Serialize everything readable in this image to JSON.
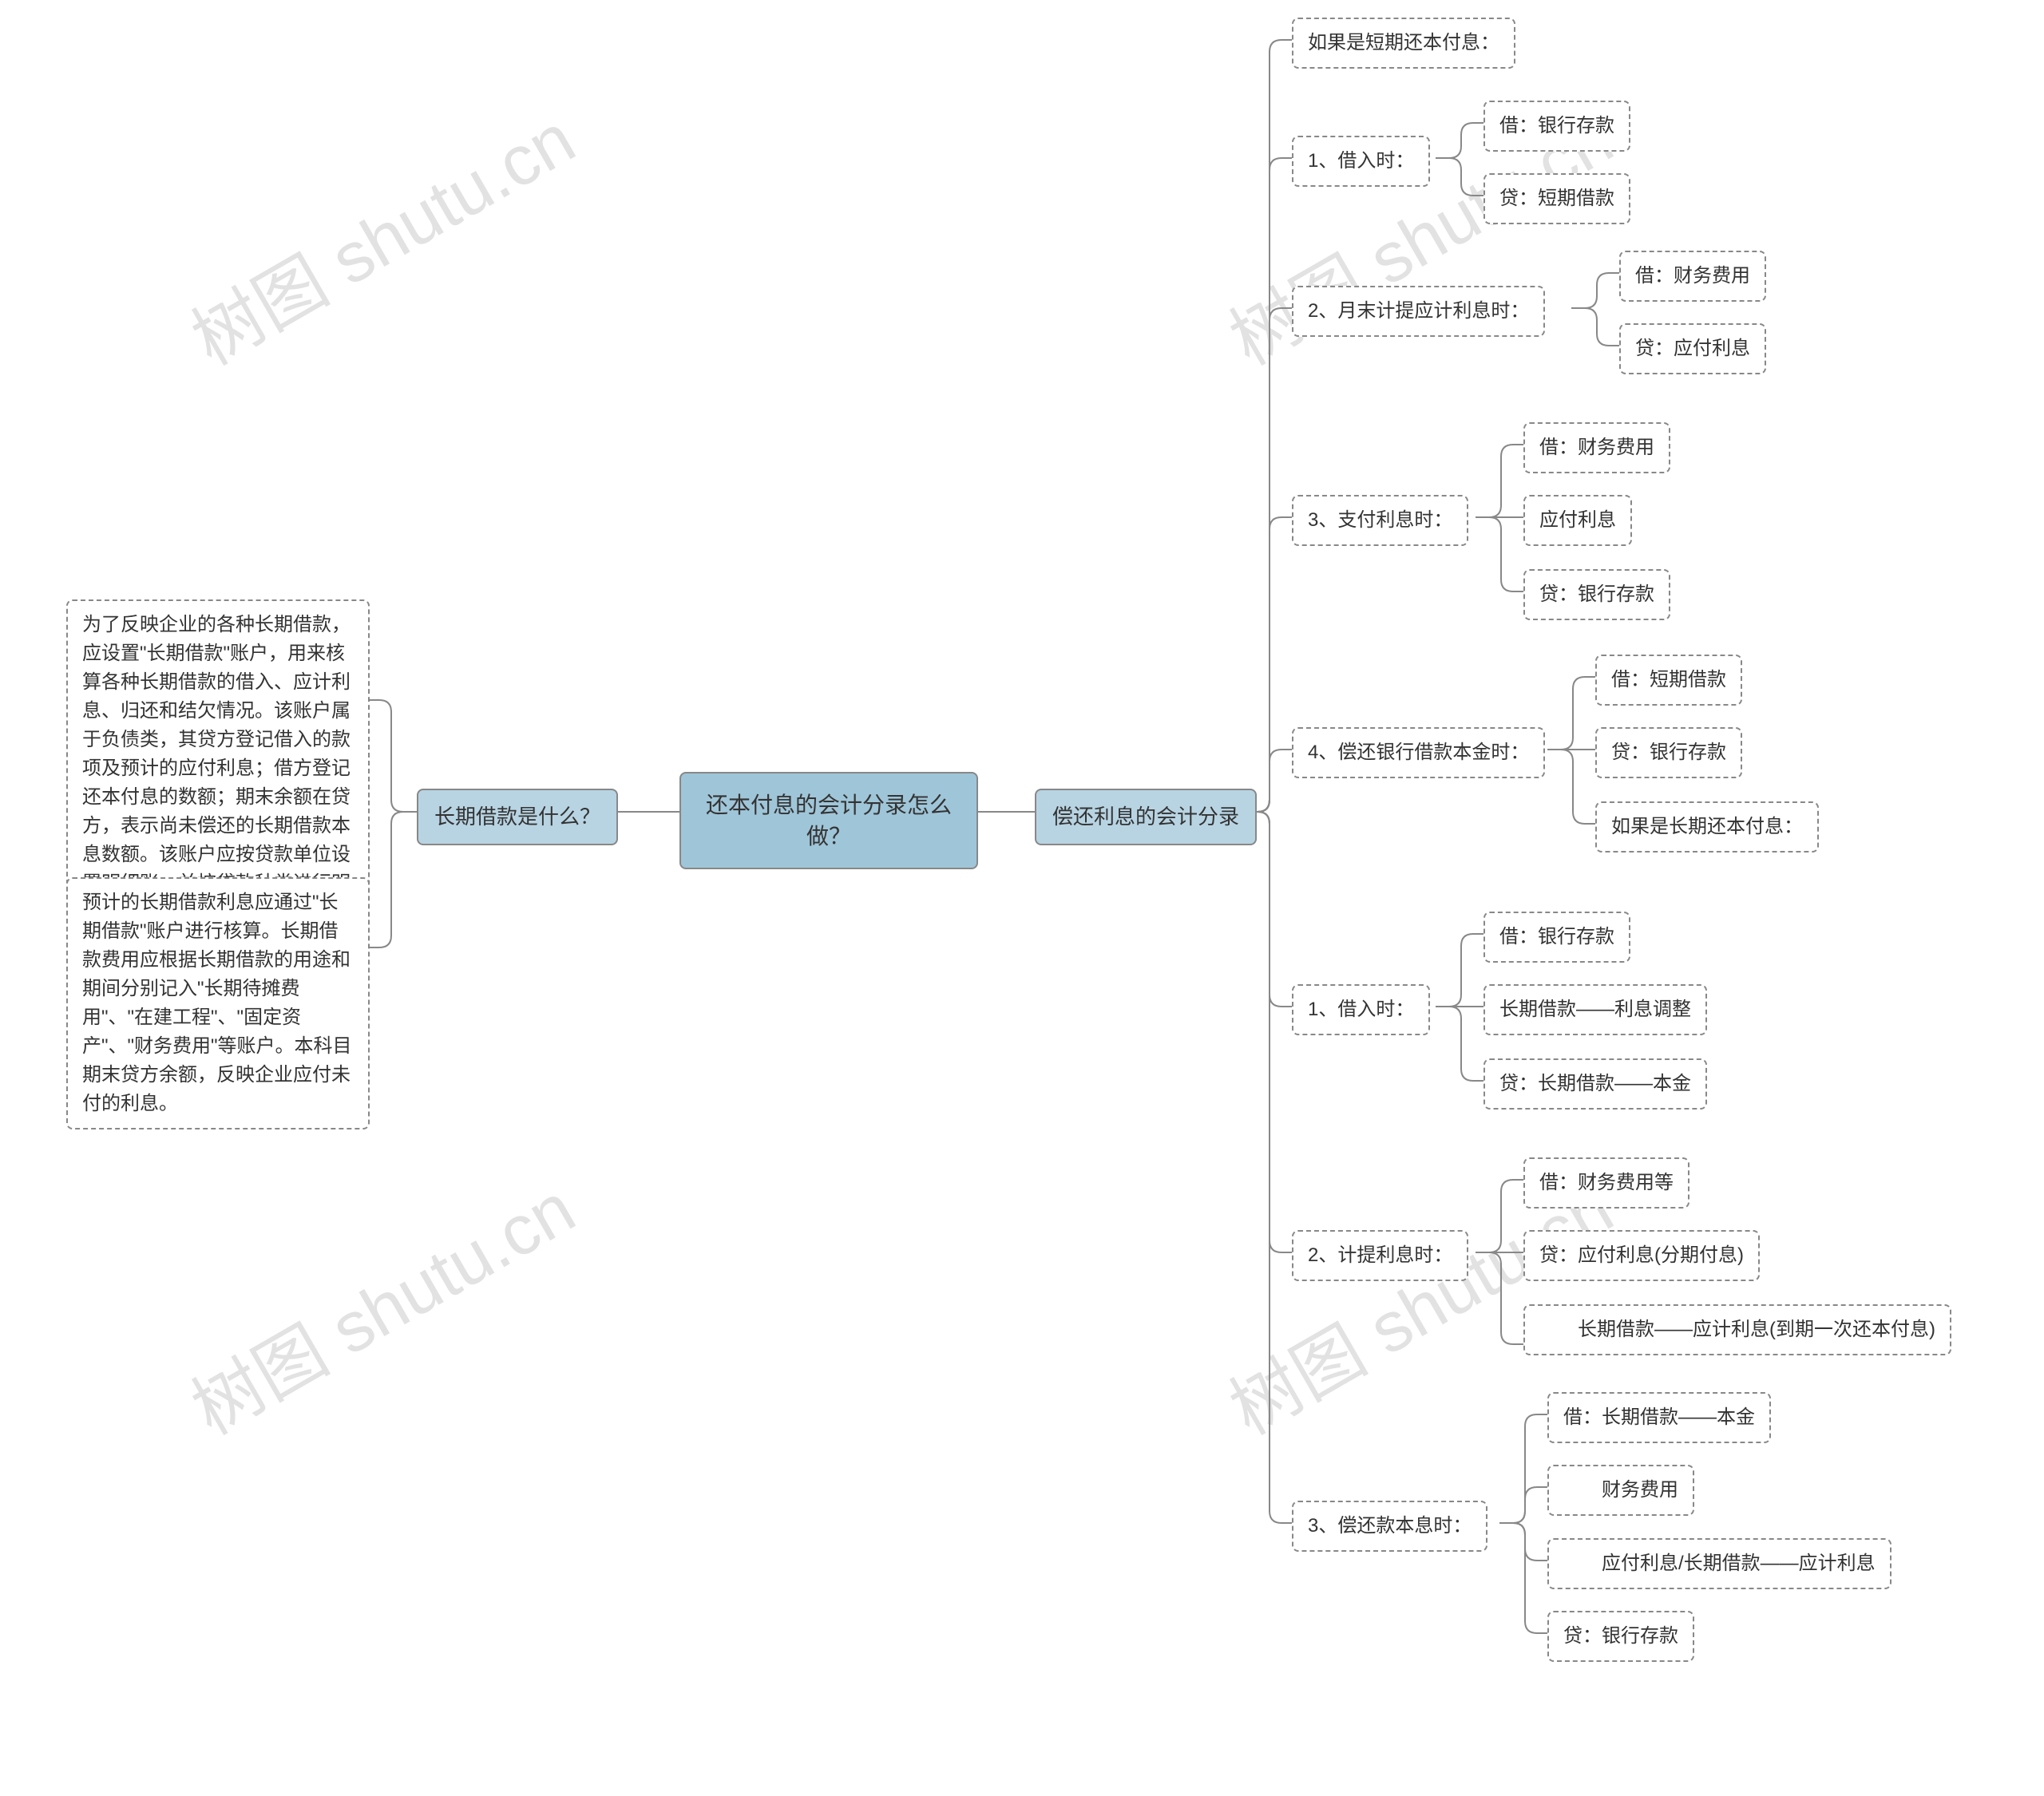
{
  "root": {
    "title": "还本付息的会计分录怎么做？"
  },
  "left": {
    "branch": "长期借款是什么？",
    "paras": [
      "为了反映企业的各种长期借款，应设置\"长期借款\"账户，用来核算各种长期借款的借入、应计利息、归还和结欠情况。该账户属于负债类，其贷方登记借入的款项及预计的应付利息；借方登记还本付息的数额；期末余额在贷方，表示尚未偿还的长期借款本息数额。该账户应按贷款单位设置明细账，并按贷款种类进行明细核算。",
      "预计的长期借款利息应通过\"长期借款\"账户进行核算。长期借款费用应根据长期借款的用途和期间分别记入\"长期待摊费用\"、\"在建工程\"、\"固定资产\"、\"财务费用\"等账户。本科目期末贷方余额，反映企业应付未付的利息。"
    ]
  },
  "right": {
    "branch": "偿还利息的会计分录",
    "shortTitle": "如果是短期还本付息：",
    "short": {
      "s1": {
        "label": "1、借入时：",
        "items": [
          "借：银行存款",
          "贷：短期借款"
        ]
      },
      "s2": {
        "label": "2、月末计提应计利息时：",
        "items": [
          "借：财务费用",
          "贷：应付利息"
        ]
      },
      "s3": {
        "label": "3、支付利息时：",
        "items": [
          "借：财务费用",
          "应付利息",
          "贷：银行存款"
        ]
      },
      "s4": {
        "label": "4、偿还银行借款本金时：",
        "items": [
          "借：短期借款",
          "贷：银行存款",
          "如果是长期还本付息："
        ]
      }
    },
    "long": {
      "l1": {
        "label": "1、借入时：",
        "items": [
          "借：银行存款",
          "长期借款——利息调整",
          "贷：长期借款——本金"
        ]
      },
      "l2": {
        "label": "2、计提利息时：",
        "items": [
          "借：财务费用等",
          "贷：应付利息(分期付息)",
          "　　长期借款——应计利息(到期一次还本付息)"
        ]
      },
      "l3": {
        "label": "3、偿还款本息时：",
        "items": [
          "借：长期借款——本金",
          "　　财务费用",
          "　　应付利息/长期借款——应计利息",
          "贷：银行存款"
        ]
      }
    }
  },
  "watermark": "树图 shutu.cn"
}
